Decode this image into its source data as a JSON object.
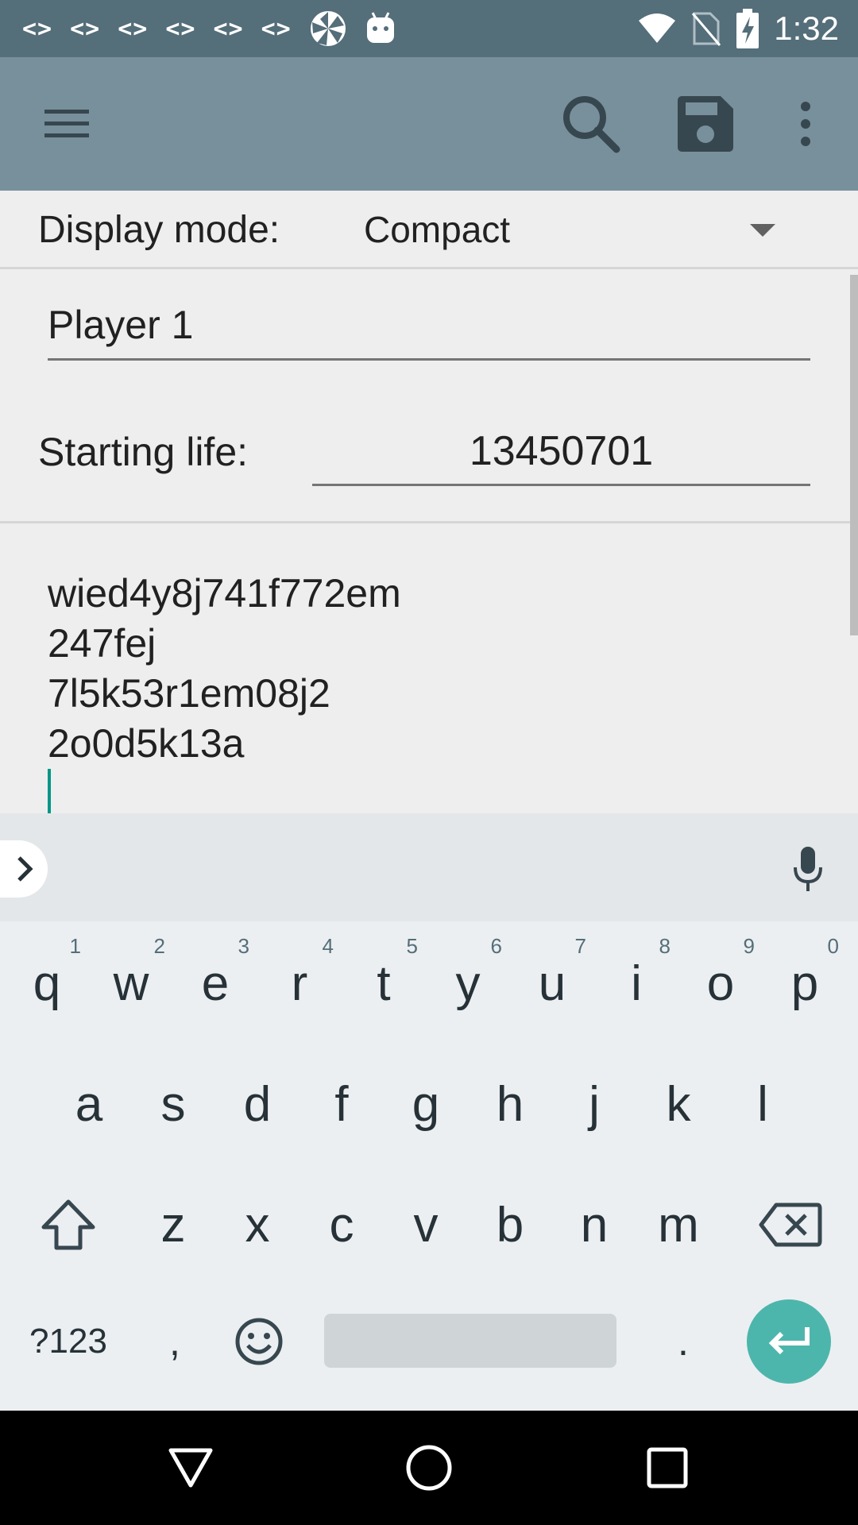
{
  "status_bar": {
    "notification_codes": [
      "<>",
      "<>",
      "<>",
      "<>",
      "<>",
      "<>"
    ],
    "icons": [
      "debug-code-icon",
      "pinwheel-icon",
      "android-icon",
      "wifi-icon",
      "no-sim-icon",
      "battery-charging-icon"
    ],
    "time": "1:32"
  },
  "toolbar": {
    "menu_icon": "hamburger-menu-icon",
    "search_icon": "search-icon",
    "save_icon": "save-icon",
    "overflow_icon": "more-vert-icon",
    "background": "#78909c"
  },
  "display_mode": {
    "label": "Display mode:",
    "value": "Compact"
  },
  "player": {
    "name": "Player 1",
    "starting_life_label": "Starting life:",
    "starting_life": "13450701"
  },
  "notes": {
    "lines": [
      "wied4y8j741f772em",
      "247fej",
      "7l5k53r1em08j2",
      "2o0d5k13a"
    ]
  },
  "keyboard": {
    "row1": [
      {
        "key": "q",
        "hint": "1"
      },
      {
        "key": "w",
        "hint": "2"
      },
      {
        "key": "e",
        "hint": "3"
      },
      {
        "key": "r",
        "hint": "4"
      },
      {
        "key": "t",
        "hint": "5"
      },
      {
        "key": "y",
        "hint": "6"
      },
      {
        "key": "u",
        "hint": "7"
      },
      {
        "key": "i",
        "hint": "8"
      },
      {
        "key": "o",
        "hint": "9"
      },
      {
        "key": "p",
        "hint": "0"
      }
    ],
    "row2": [
      "a",
      "s",
      "d",
      "f",
      "g",
      "h",
      "j",
      "k",
      "l"
    ],
    "row3": [
      "z",
      "x",
      "c",
      "v",
      "b",
      "n",
      "m"
    ],
    "symbols_label": "?123",
    "comma": ",",
    "period": ".",
    "accent": "#4db6ac"
  },
  "nav_bar": {
    "icons": [
      "back-icon",
      "home-icon",
      "recents-icon"
    ]
  }
}
